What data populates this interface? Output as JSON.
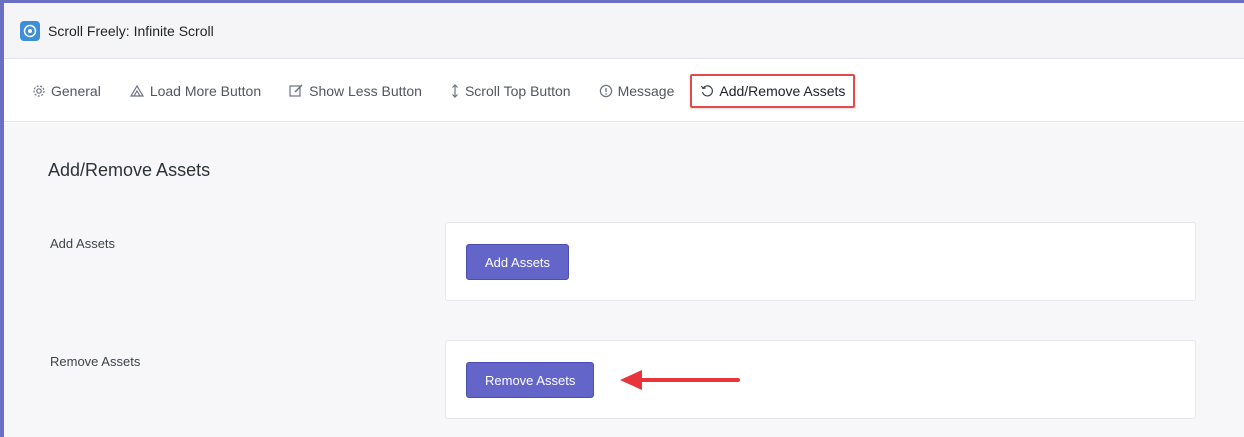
{
  "window": {
    "title": "Scroll Freely: Infinite Scroll",
    "logo_icon": "app-logo-icon"
  },
  "tabs": [
    {
      "label": "General",
      "icon": "gear-icon"
    },
    {
      "label": "Load More Button",
      "icon": "load-more-icon"
    },
    {
      "label": "Show Less Button",
      "icon": "edit-icon"
    },
    {
      "label": "Scroll Top Button",
      "icon": "up-down-arrow-icon"
    },
    {
      "label": "Message",
      "icon": "info-circle-icon"
    },
    {
      "label": "Add/Remove Assets",
      "icon": "refresh-icon",
      "active": true
    }
  ],
  "main": {
    "section_title": "Add/Remove Assets",
    "rows": [
      {
        "label": "Add Assets",
        "button_label": "Add Assets"
      },
      {
        "label": "Remove Assets",
        "button_label": "Remove Assets"
      }
    ]
  },
  "colors": {
    "accent": "#6366c8",
    "frame": "#6b6fc4",
    "highlight": "#e34b4b"
  }
}
